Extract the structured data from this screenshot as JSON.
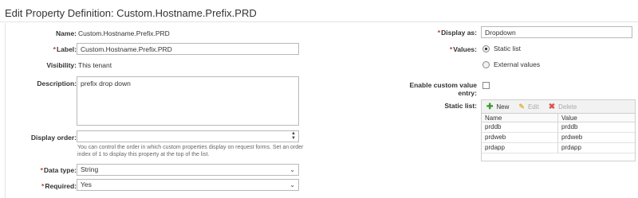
{
  "header": {
    "title": "Edit Property Definition: Custom.Hostname.Prefix.PRD"
  },
  "left": {
    "name": {
      "label": "Name:",
      "value": "Custom.Hostname.Prefix.PRD"
    },
    "label_field": {
      "required_mark": "*",
      "label": "Label:",
      "value": "Custom.Hostname.Prefix.PRD"
    },
    "visibility": {
      "label": "Visibility:",
      "value": "This tenant"
    },
    "description": {
      "label": "Description:",
      "value": "prefix drop down"
    },
    "display_order": {
      "label": "Display order:",
      "value": "",
      "help_line1": "You can control the order in which custom properties display on request forms. Set an order",
      "help_line2": "index of 1 to display this property at the top of the list."
    },
    "data_type": {
      "required_mark": "*",
      "label": "Data type:",
      "value": "String"
    },
    "required": {
      "required_mark": "*",
      "label": "Required:",
      "value": "Yes"
    }
  },
  "right": {
    "display_as": {
      "required_mark": "*",
      "label": "Display as:",
      "value": "Dropdown"
    },
    "values": {
      "required_mark": "*",
      "label": "Values:",
      "options": [
        {
          "label": "Static list",
          "selected": true
        },
        {
          "label": "External values",
          "selected": false
        }
      ]
    },
    "custom_entry": {
      "label_line1": "Enable custom value",
      "label_line2": "entry:",
      "checked": false
    },
    "static_list": {
      "label": "Static list:",
      "toolbar": {
        "new": "New",
        "edit": "Edit",
        "delete": "Delete"
      },
      "columns": [
        "Name",
        "Value"
      ],
      "rows": [
        {
          "name": "prddb",
          "value": "prddb"
        },
        {
          "name": "prdweb",
          "value": "prdweb"
        },
        {
          "name": "prdapp",
          "value": "prdapp"
        }
      ]
    }
  },
  "colors": {
    "required": "#c0392b",
    "new_icon": "#3c9b2f",
    "delete_icon": "#d9534f",
    "edit_icon": "#e0b84b"
  }
}
